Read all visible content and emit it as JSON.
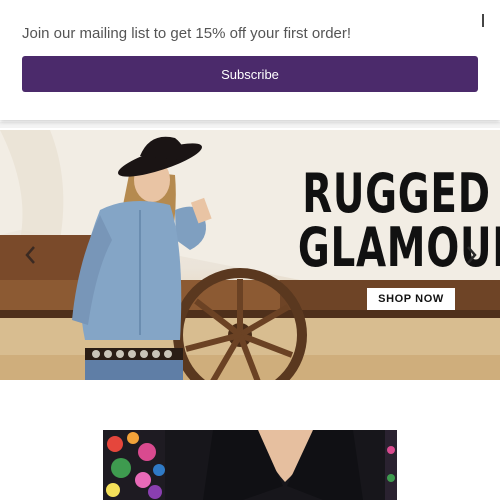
{
  "popup": {
    "message": "Join our mailing list to get 15% off your first order!",
    "subscribe_label": "Subscribe",
    "close_glyph": "I",
    "accent": "#4b2a6b"
  },
  "hero": {
    "headline_line1": "RUGGED",
    "headline_line2": "GLAMOUR",
    "cta_label": "SHOP NOW",
    "prev_icon": "chevron-left-icon",
    "next_icon": "chevron-right-icon"
  },
  "product": {
    "image": "floral-kimono-product-photo"
  }
}
